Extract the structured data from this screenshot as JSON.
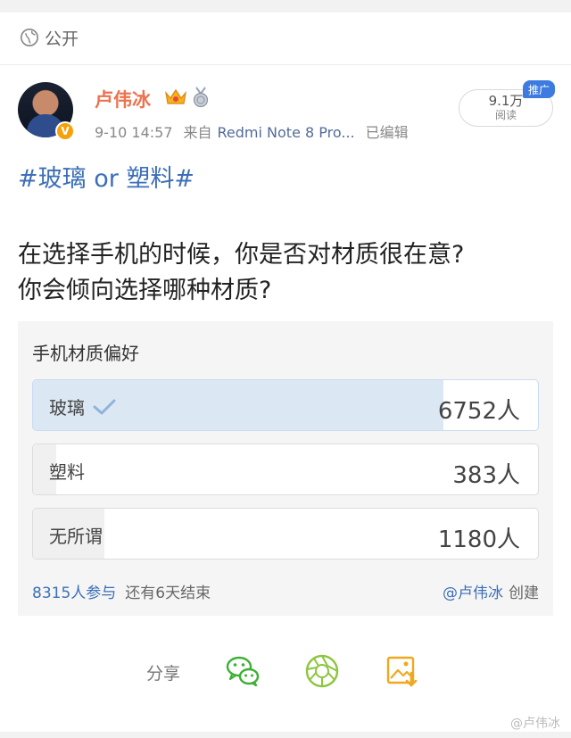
{
  "visibility": {
    "label": "公开",
    "icon": "globe-icon"
  },
  "post": {
    "author": "卢伟冰",
    "badges": [
      "crown-badge-icon",
      "medal-badge-icon"
    ],
    "verified_mark": "V",
    "time": "9-10 14:57",
    "source_prefix": "来自",
    "device": "Redmi Note 8 Pro...",
    "edited": "已编辑",
    "reads": {
      "count": "9.1万",
      "label": "阅读"
    },
    "promo_tag": "推广",
    "topic": "#玻璃 or 塑料#",
    "question_line1": "在选择手机的时候，你是否对材质很在意?",
    "question_line2": "你会倾向选择哪种材质?"
  },
  "vote": {
    "title": "手机材质偏好",
    "options": [
      {
        "label": "玻璃",
        "count": "6752人",
        "selected": true,
        "share": 0.812
      },
      {
        "label": "塑料",
        "count": "383人",
        "selected": false,
        "share": 0.046
      },
      {
        "label": "无所谓",
        "count": "1180人",
        "selected": false,
        "share": 0.142
      }
    ],
    "participants": "8315人参与",
    "remaining": "还有6天结束",
    "creator": "@卢伟冰",
    "creator_suffix": "创建"
  },
  "share": {
    "label": "分享",
    "targets": [
      "wechat-icon",
      "moments-icon",
      "save-image-icon"
    ]
  },
  "watermark": "@卢伟冰",
  "colors": {
    "accent": "#3c6fb8",
    "username": "#eb7350",
    "selected_fill": "#dbe8f4",
    "promo": "#3d7be0"
  }
}
